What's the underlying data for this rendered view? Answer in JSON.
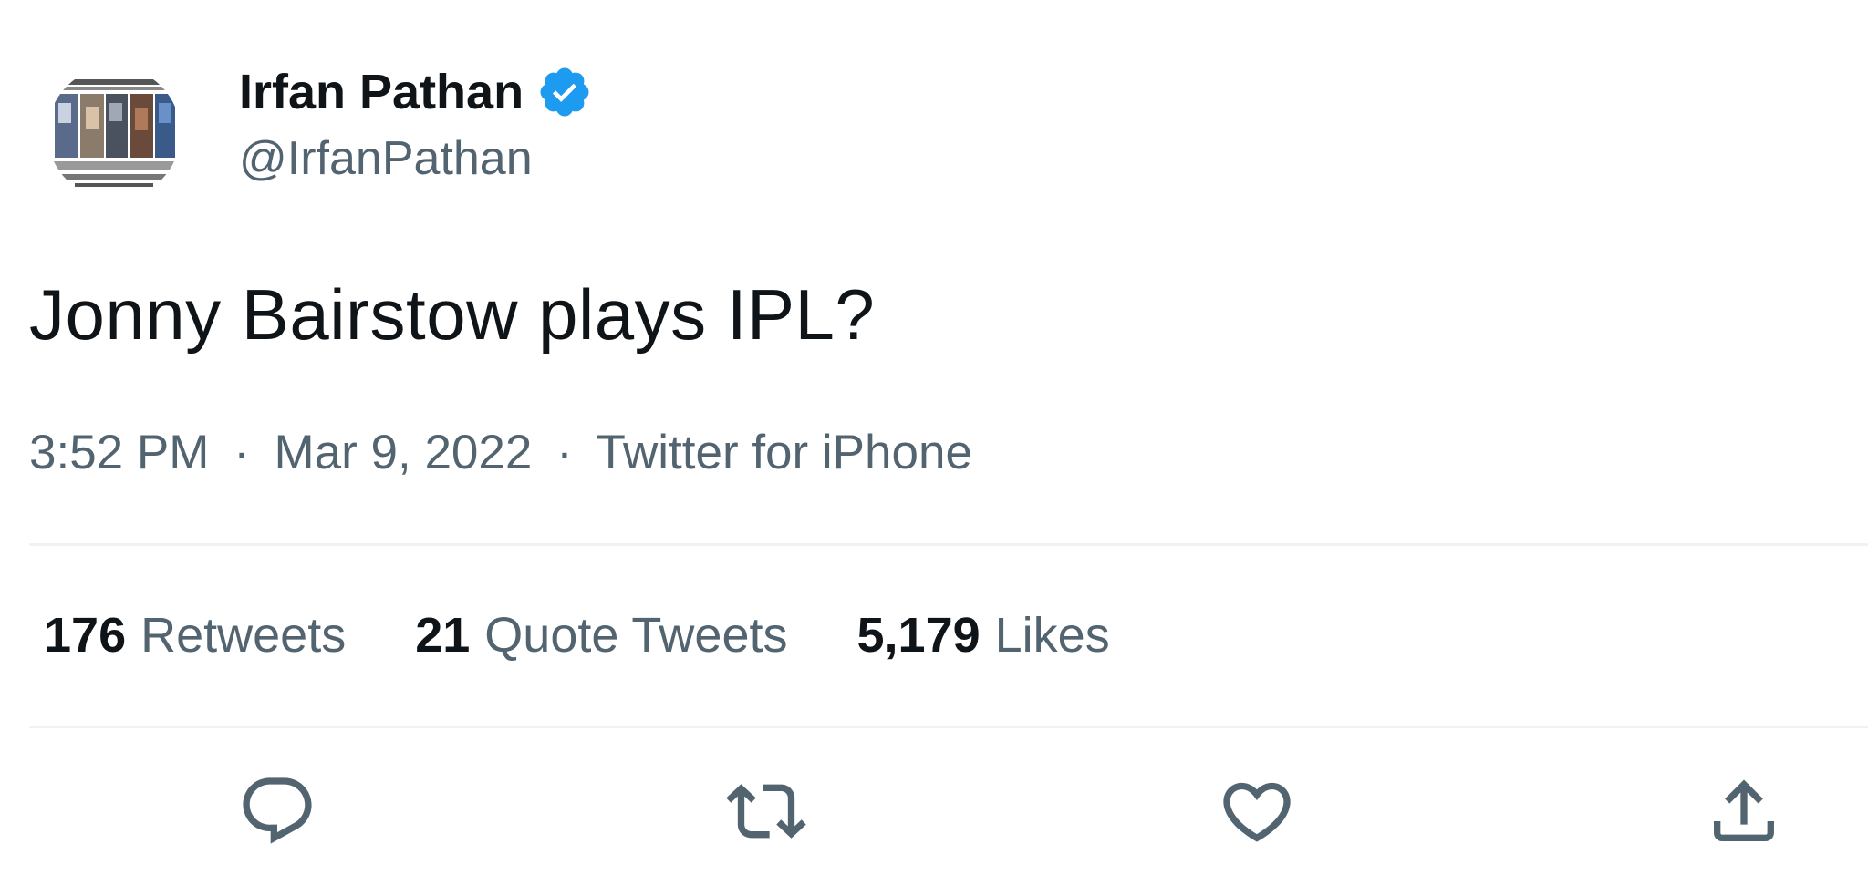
{
  "author": {
    "display_name": "Irfan Pathan",
    "handle": "@IrfanPathan",
    "verified": true,
    "verified_icon": "verified-badge-icon",
    "avatar_icon": "profile-avatar"
  },
  "tweet": {
    "text": "Jonny Bairstow plays IPL?",
    "time": "3:52 PM",
    "date": "Mar 9, 2022",
    "source": "Twitter for iPhone",
    "separator": "·"
  },
  "stats": {
    "retweets_count": "176",
    "retweets_label": "Retweets",
    "quotes_count": "21",
    "quotes_label": "Quote Tweets",
    "likes_count": "5,179",
    "likes_label": "Likes"
  },
  "actions": {
    "reply_icon": "reply-icon",
    "retweet_icon": "retweet-icon",
    "like_icon": "heart-icon",
    "share_icon": "share-icon"
  },
  "colors": {
    "text_primary": "#0f1419",
    "text_secondary": "#536471",
    "divider": "#eff3f4",
    "verified_blue": "#1d9bf0"
  }
}
